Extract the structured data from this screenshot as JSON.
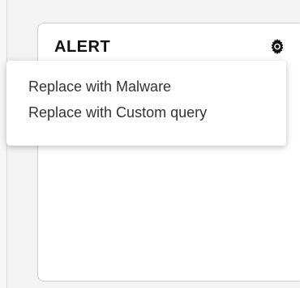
{
  "panel": {
    "title": "ALERT",
    "settings_icon": "gear-icon"
  },
  "menu": {
    "items": [
      {
        "label": "Replace with Malware"
      },
      {
        "label": "Replace with Custom query"
      }
    ]
  }
}
